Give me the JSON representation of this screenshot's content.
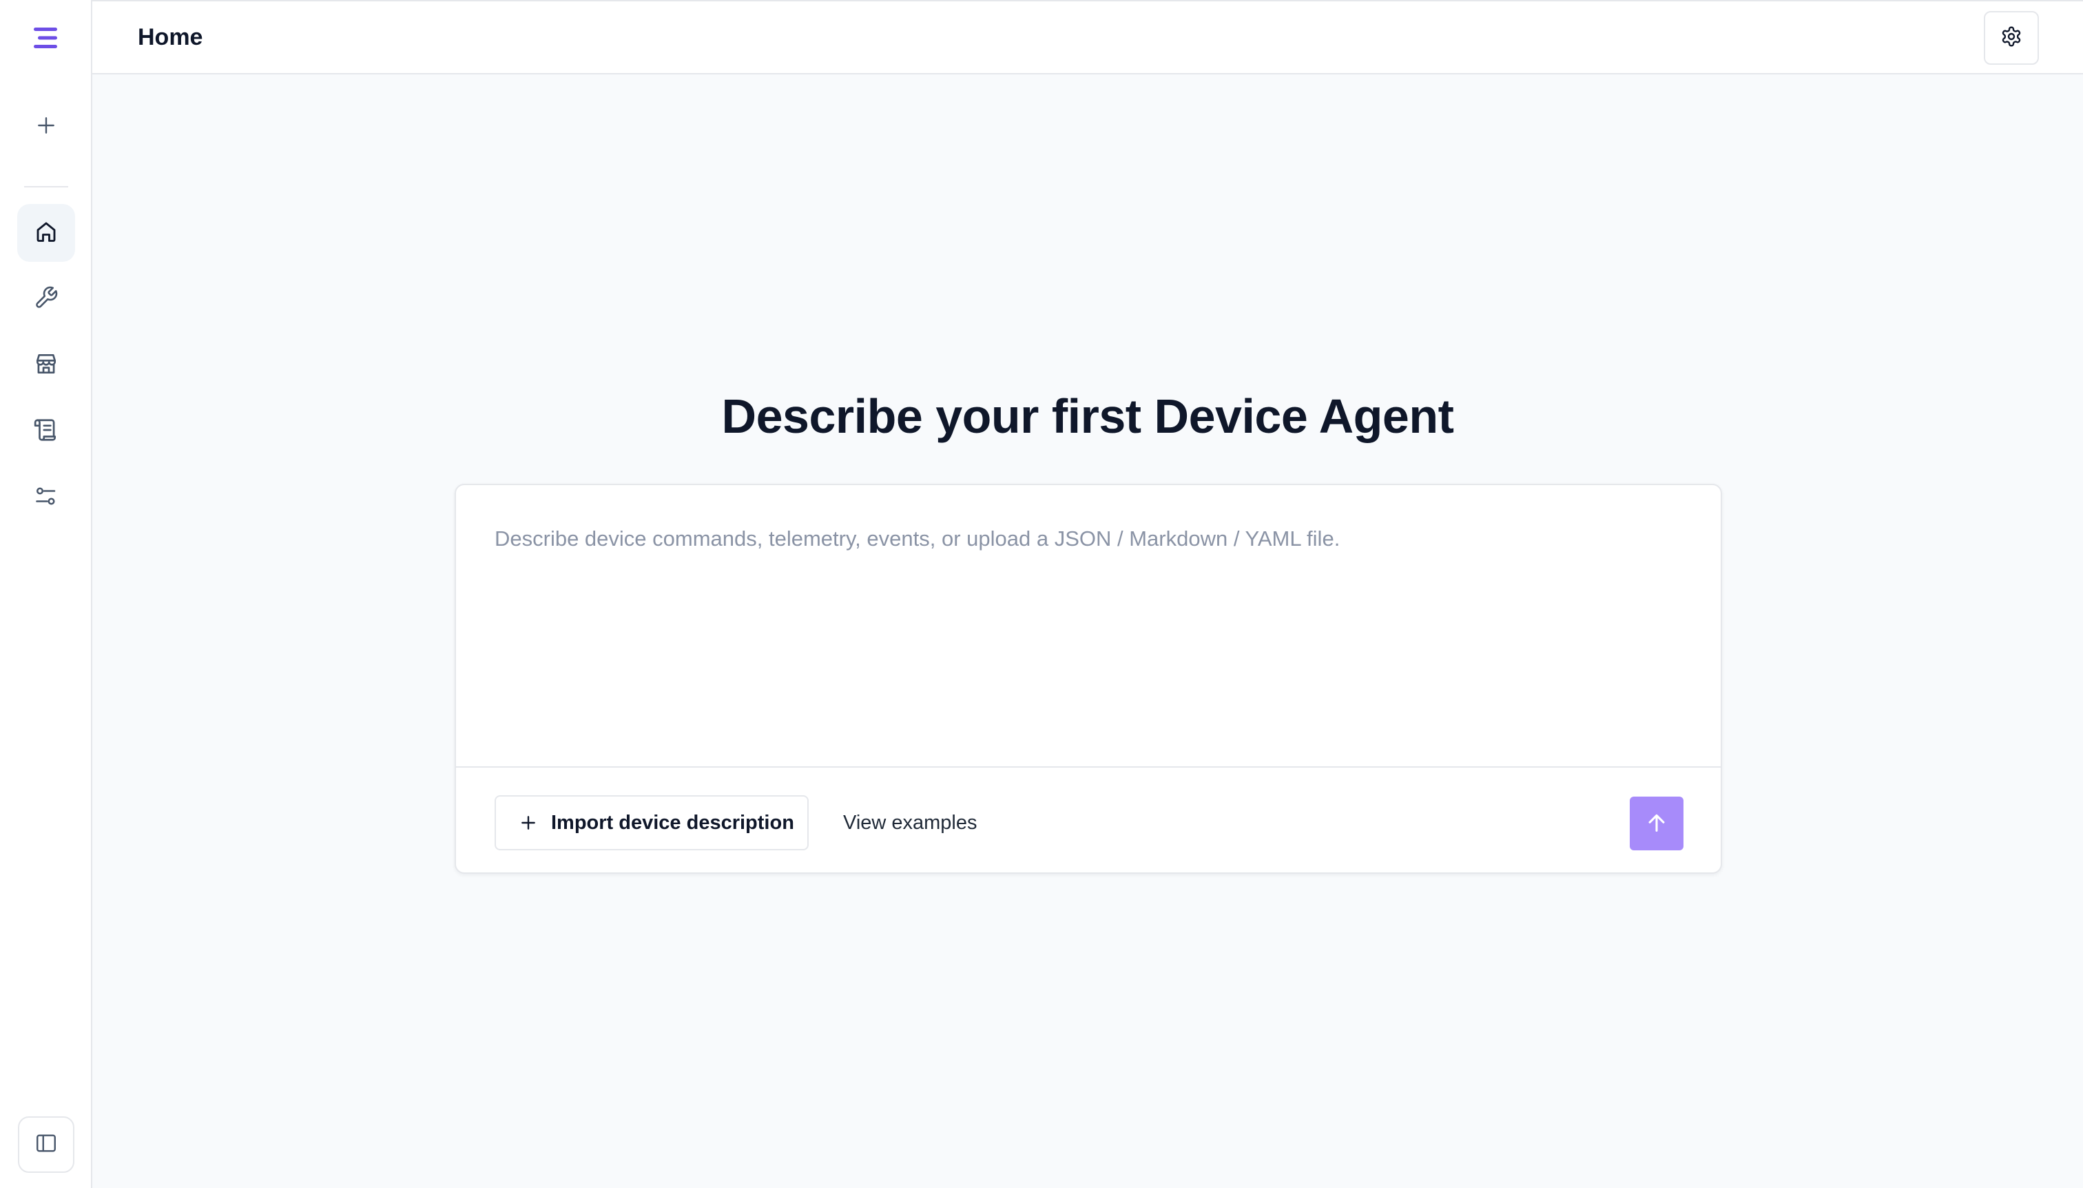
{
  "header": {
    "title": "Home"
  },
  "sidebar": {
    "logo_icon": "menu-lines-icon",
    "items": [
      {
        "name": "new",
        "icon": "plus-icon"
      },
      {
        "name": "home",
        "icon": "home-icon",
        "active": true
      },
      {
        "name": "tools",
        "icon": "wrench-icon"
      },
      {
        "name": "store",
        "icon": "store-icon"
      },
      {
        "name": "scroll",
        "icon": "scroll-icon"
      },
      {
        "name": "settings-sliders",
        "icon": "sliders-icon"
      }
    ],
    "collapse_icon": "sidebar-panel-icon"
  },
  "main": {
    "title": "Describe your first Device Agent",
    "input": {
      "placeholder": "Describe device commands, telemetry, events, or upload a JSON / Markdown / YAML file.",
      "value": ""
    },
    "import_label": "Import device description",
    "examples_label": "View examples"
  },
  "colors": {
    "accent": "#6d4ee6",
    "send_button": "#a78bfa",
    "background": "#f8fafc",
    "border": "#e5e7eb"
  }
}
